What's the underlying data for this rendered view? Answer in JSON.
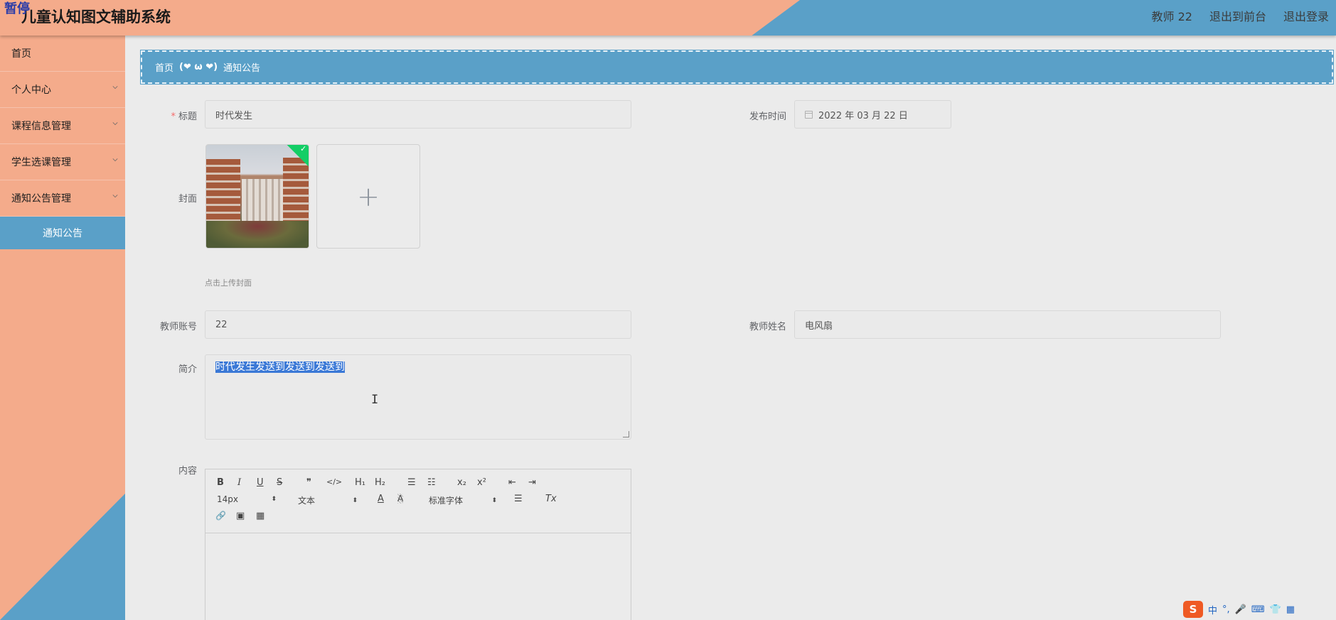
{
  "header": {
    "badge": "暂停",
    "title": "儿童认知图文辅助系统",
    "user": "教师 22",
    "exit_front": "退出到前台",
    "logout": "退出登录"
  },
  "sidebar": {
    "items": [
      {
        "label": "首页"
      },
      {
        "label": "个人中心"
      },
      {
        "label": "课程信息管理"
      },
      {
        "label": "学生选课管理"
      },
      {
        "label": "通知公告管理"
      },
      {
        "label": "通知公告"
      }
    ]
  },
  "breadcrumb": {
    "home": "首页",
    "separator": "(❤ ω ❤)",
    "current": "通知公告"
  },
  "form": {
    "title_label": "标题",
    "title_required": "*",
    "title_value": "时代发生",
    "publish_label": "发布时间",
    "publish_value": "2022 年 03 月 22 日",
    "cover_label": "封面",
    "cover_hint": "点击上传封面",
    "teacher_account_label": "教师账号",
    "teacher_account_value": "22",
    "teacher_name_label": "教师姓名",
    "teacher_name_value": "电风扇",
    "intro_label": "简介",
    "intro_value": "时代发生发送到发送到发送到",
    "content_label": "内容"
  },
  "editor": {
    "font_size": "14px",
    "block_type": "文本",
    "font_family": "标准字体",
    "buttons": {
      "bold": "B",
      "italic": "I",
      "underline": "U",
      "strike": "S",
      "quote": "❞",
      "code": "</>",
      "h1": "H₁",
      "h2": "H₂",
      "ordered_list": "☰",
      "bullet_list": "☷",
      "subscript": "x₂",
      "superscript": "x²",
      "outdent": "⇤",
      "indent": "⇥",
      "color": "A",
      "background": "A",
      "align": "☰",
      "clean": "Tx",
      "link": "🔗",
      "image": "▣",
      "video": "▦"
    }
  },
  "ime": {
    "label_zh": "中",
    "punct": "°,",
    "logo": "S"
  },
  "colors": {
    "salmon": "#f4ab8b",
    "blue": "#5aa0c8"
  }
}
